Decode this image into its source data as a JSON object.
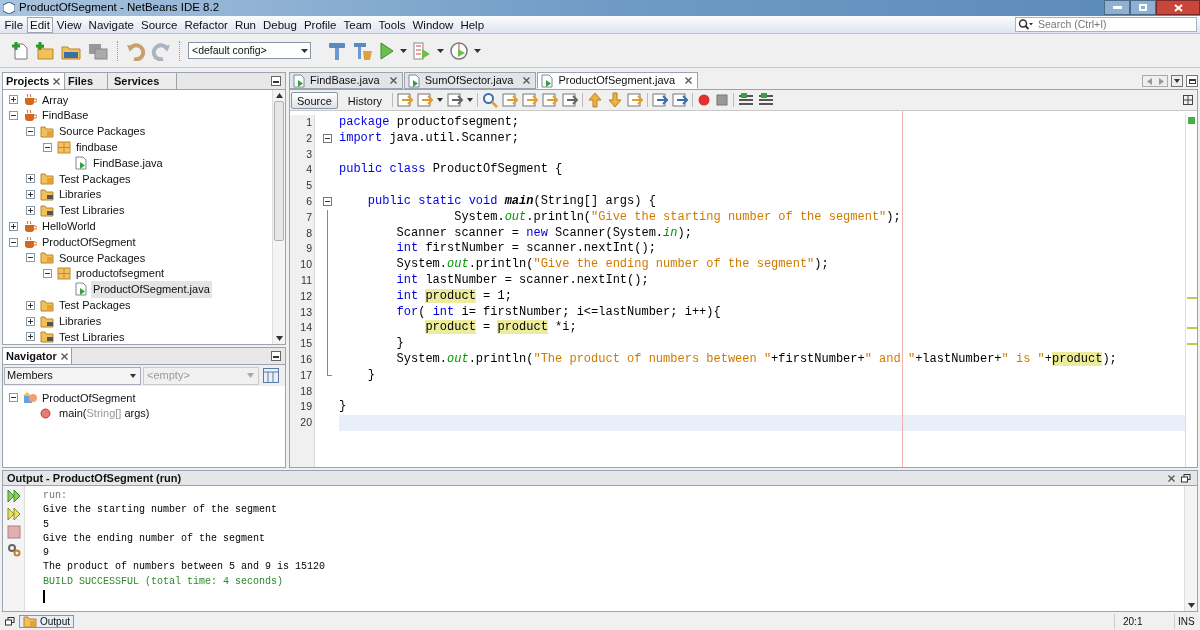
{
  "window": {
    "title": "ProductOfSegment - NetBeans IDE 8.2"
  },
  "menu": [
    {
      "label": "File",
      "selected": false
    },
    {
      "label": "Edit",
      "selected": true
    },
    {
      "label": "View",
      "selected": false
    },
    {
      "label": "Navigate",
      "selected": false
    },
    {
      "label": "Source",
      "selected": false
    },
    {
      "label": "Refactor",
      "selected": false
    },
    {
      "label": "Run",
      "selected": false
    },
    {
      "label": "Debug",
      "selected": false
    },
    {
      "label": "Profile",
      "selected": false
    },
    {
      "label": "Team",
      "selected": false
    },
    {
      "label": "Tools",
      "selected": false
    },
    {
      "label": "Window",
      "selected": false
    },
    {
      "label": "Help",
      "selected": false
    }
  ],
  "search": {
    "placeholder": "Search (Ctrl+I)"
  },
  "toolbar": {
    "config": "<default config>"
  },
  "projects_panel": {
    "tabs": [
      {
        "label": "Projects",
        "selected": true
      },
      {
        "label": "Files",
        "selected": false
      },
      {
        "label": "Services",
        "selected": false
      }
    ],
    "tree": [
      {
        "label": "Array",
        "kind": "project",
        "expanded": false,
        "selected": false
      },
      {
        "label": "FindBase",
        "kind": "project",
        "expanded": true,
        "selected": false,
        "children": [
          {
            "label": "Source Packages",
            "kind": "folder",
            "expanded": true,
            "selected": false,
            "children": [
              {
                "label": "findbase",
                "kind": "package",
                "expanded": true,
                "selected": false,
                "children": [
                  {
                    "label": "FindBase.java",
                    "kind": "file",
                    "selected": false
                  }
                ]
              }
            ]
          },
          {
            "label": "Test Packages",
            "kind": "folder",
            "expanded": false,
            "selected": false
          },
          {
            "label": "Libraries",
            "kind": "library",
            "expanded": false,
            "selected": false
          },
          {
            "label": "Test Libraries",
            "kind": "library",
            "expanded": false,
            "selected": false
          }
        ]
      },
      {
        "label": "HelloWorld",
        "kind": "project",
        "expanded": false,
        "selected": false
      },
      {
        "label": "ProductOfSegment",
        "kind": "project",
        "expanded": true,
        "selected": false,
        "children": [
          {
            "label": "Source Packages",
            "kind": "folder",
            "expanded": true,
            "selected": false,
            "children": [
              {
                "label": "productofsegment",
                "kind": "package",
                "expanded": true,
                "selected": false,
                "children": [
                  {
                    "label": "ProductOfSegment.java",
                    "kind": "file",
                    "selected": true
                  }
                ]
              }
            ]
          },
          {
            "label": "Test Packages",
            "kind": "folder",
            "expanded": false,
            "selected": false
          },
          {
            "label": "Libraries",
            "kind": "library",
            "expanded": false,
            "selected": false
          },
          {
            "label": "Test Libraries",
            "kind": "library",
            "expanded": false,
            "selected": false
          }
        ]
      }
    ]
  },
  "navigator": {
    "title": "Navigator",
    "filter": "Members",
    "second_filter": "<empty>",
    "tree": [
      {
        "label": "ProductOfSegment",
        "kind": "class",
        "expanded": true,
        "children": [
          {
            "kind": "method",
            "label": "main(",
            "param_type": "String[]",
            "param_name": " args)"
          }
        ]
      }
    ]
  },
  "editor": {
    "tabs": [
      {
        "label": "FindBase.java",
        "selected": false
      },
      {
        "label": "SumOfSector.java",
        "selected": false
      },
      {
        "label": "ProductOfSegment.java",
        "selected": true
      }
    ],
    "modes": [
      {
        "label": "Source",
        "selected": true
      },
      {
        "label": "History",
        "selected": false
      }
    ],
    "lines": [
      {
        "number": "1",
        "tokens": [
          {
            "kind": "keyword",
            "text": "package"
          },
          {
            "kind": "plain",
            "text": " productofsegment;"
          }
        ]
      },
      {
        "number": "2",
        "fold_toggle": true,
        "tokens": [
          {
            "kind": "keyword",
            "text": "import"
          },
          {
            "kind": "plain",
            "text": " java.util.Scanner;"
          }
        ]
      },
      {
        "number": "3"
      },
      {
        "number": "4",
        "tokens": [
          {
            "kind": "keyword",
            "text": "public class"
          },
          {
            "kind": "plain",
            "text": " ProductOfSegment {"
          }
        ]
      },
      {
        "number": "5"
      },
      {
        "number": "6",
        "fold_toggle": true,
        "tokens": [
          {
            "kind": "keyword",
            "text": "    public static void"
          },
          {
            "kind": "decl",
            "text": " main"
          },
          {
            "kind": "plain",
            "text": "(String[] args) {"
          }
        ]
      },
      {
        "number": "7",
        "in_fold": true,
        "tokens": [
          {
            "kind": "plain",
            "text": "                System."
          },
          {
            "kind": "field",
            "text": "out"
          },
          {
            "kind": "plain",
            "text": ".println("
          },
          {
            "kind": "string",
            "text": "\"Give the starting number of the segment\""
          },
          {
            "kind": "plain",
            "text": ");"
          }
        ]
      },
      {
        "number": "8",
        "in_fold": true,
        "tokens": [
          {
            "kind": "plain",
            "text": "        Scanner scanner = "
          },
          {
            "kind": "keyword",
            "text": "new"
          },
          {
            "kind": "plain",
            "text": " Scanner(System."
          },
          {
            "kind": "field",
            "text": "in"
          },
          {
            "kind": "plain",
            "text": ");"
          }
        ]
      },
      {
        "number": "9",
        "in_fold": true,
        "tokens": [
          {
            "kind": "keyword",
            "text": "        int"
          },
          {
            "kind": "plain",
            "text": " firstNumber = scanner.nextInt();"
          }
        ]
      },
      {
        "number": "10",
        "in_fold": true,
        "tokens": [
          {
            "kind": "plain",
            "text": "        System."
          },
          {
            "kind": "field",
            "text": "out"
          },
          {
            "kind": "plain",
            "text": ".println("
          },
          {
            "kind": "string",
            "text": "\"Give the ending number of the segment\""
          },
          {
            "kind": "plain",
            "text": ");"
          }
        ]
      },
      {
        "number": "11",
        "in_fold": true,
        "tokens": [
          {
            "kind": "keyword",
            "text": "        int"
          },
          {
            "kind": "plain",
            "text": " lastNumber = scanner.nextInt();"
          }
        ]
      },
      {
        "number": "12",
        "in_fold": true,
        "tokens": [
          {
            "kind": "keyword",
            "text": "        int"
          },
          {
            "kind": "mark",
            "text": " product"
          },
          {
            "kind": "plain",
            "text": " = 1;"
          }
        ]
      },
      {
        "number": "13",
        "in_fold": true,
        "tokens": [
          {
            "kind": "keyword",
            "text": "        for"
          },
          {
            "kind": "plain",
            "text": "( "
          },
          {
            "kind": "keyword",
            "text": "int"
          },
          {
            "kind": "plain",
            "text": " i= firstNumber; i<=lastNumber; i++){"
          }
        ]
      },
      {
        "number": "14",
        "in_fold": true,
        "tokens": [
          {
            "kind": "mark",
            "text": "            product"
          },
          {
            "kind": "plain",
            "text": " = "
          },
          {
            "kind": "mark",
            "text": "product"
          },
          {
            "kind": "plain",
            "text": " *i;"
          }
        ]
      },
      {
        "number": "15",
        "in_fold": true,
        "tokens": [
          {
            "kind": "plain",
            "text": "        }"
          }
        ]
      },
      {
        "number": "16",
        "in_fold": true,
        "tokens": [
          {
            "kind": "plain",
            "text": "        System."
          },
          {
            "kind": "field",
            "text": "out"
          },
          {
            "kind": "plain",
            "text": ".println("
          },
          {
            "kind": "string",
            "text": "\"The product of numbers between \""
          },
          {
            "kind": "plain",
            "text": "+firstNumber+"
          },
          {
            "kind": "string",
            "text": "\" and \""
          },
          {
            "kind": "plain",
            "text": "+lastNumber+"
          },
          {
            "kind": "string",
            "text": "\" is \""
          },
          {
            "kind": "plain",
            "text": "+"
          },
          {
            "kind": "mark",
            "text": "product"
          },
          {
            "kind": "plain",
            "text": ");"
          }
        ]
      },
      {
        "number": "17",
        "fold_end": true,
        "tokens": [
          {
            "kind": "plain",
            "text": "    }"
          }
        ]
      },
      {
        "number": "18"
      },
      {
        "number": "19",
        "tokens": [
          {
            "kind": "plain",
            "text": "}"
          }
        ]
      },
      {
        "number": "20",
        "current": true
      }
    ]
  },
  "output": {
    "title": "Output - ProductOfSegment (run)",
    "lines": [
      {
        "kind": "dim",
        "text": "run:"
      },
      {
        "kind": "plain",
        "text": "Give the starting number of the segment"
      },
      {
        "kind": "plain",
        "text": "5"
      },
      {
        "kind": "plain",
        "text": "Give the ending number of the segment"
      },
      {
        "kind": "plain",
        "text": "9"
      },
      {
        "kind": "plain",
        "text": "The product of numbers between 5 and 9 is 15120"
      },
      {
        "kind": "success",
        "text": "BUILD SUCCESSFUL (total time: 4 seconds)"
      }
    ],
    "tab": "Output"
  },
  "status_bar": {
    "position": "20:1",
    "mode": "INS"
  }
}
